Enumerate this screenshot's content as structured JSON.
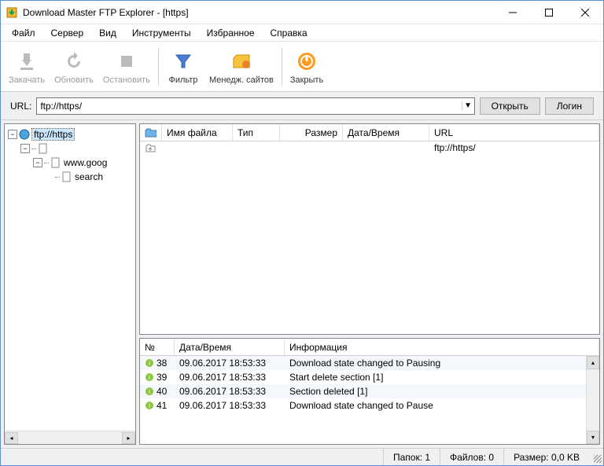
{
  "window": {
    "title": "Download Master FTP Explorer - [https]"
  },
  "menu": [
    "Файл",
    "Сервер",
    "Вид",
    "Инструменты",
    "Избранное",
    "Справка"
  ],
  "toolbar": [
    {
      "label": "Закачать",
      "icon": "download",
      "enabled": false
    },
    {
      "label": "Обновить",
      "icon": "refresh",
      "enabled": false
    },
    {
      "label": "Остановить",
      "icon": "stop",
      "enabled": false
    },
    {
      "sep": true
    },
    {
      "label": "Фильтр",
      "icon": "filter",
      "enabled": true
    },
    {
      "label": "Менедж. сайтов",
      "icon": "sites",
      "enabled": true
    },
    {
      "sep": true
    },
    {
      "label": "Закрыть",
      "icon": "close",
      "enabled": true
    }
  ],
  "url": {
    "label": "URL:",
    "value": "ftp://https/",
    "open": "Открыть",
    "login": "Логин"
  },
  "tree": {
    "root": "ftp://https",
    "node1": "",
    "node2": "www.goog",
    "node3": "search"
  },
  "filelist": {
    "columns": {
      "name": "Имя файла",
      "type": "Тип",
      "size": "Размер",
      "date": "Дата/Время",
      "url": "URL"
    },
    "rows": [
      {
        "name": "",
        "type": "",
        "size": "",
        "date": "",
        "url": "ftp://https/"
      }
    ]
  },
  "log": {
    "columns": {
      "num": "№",
      "date": "Дата/Время",
      "info": "Информация"
    },
    "rows": [
      {
        "num": "38",
        "date": "09.06.2017 18:53:33",
        "info": "Download state changed to Pausing"
      },
      {
        "num": "39",
        "date": "09.06.2017 18:53:33",
        "info": "Start delete section [1]"
      },
      {
        "num": "40",
        "date": "09.06.2017 18:53:33",
        "info": "Section deleted [1]"
      },
      {
        "num": "41",
        "date": "09.06.2017 18:53:33",
        "info": "Download state changed to Pause"
      }
    ]
  },
  "status": {
    "folders": "Папок: 1",
    "files": "Файлов: 0",
    "size": "Размер: 0,0 KB"
  }
}
